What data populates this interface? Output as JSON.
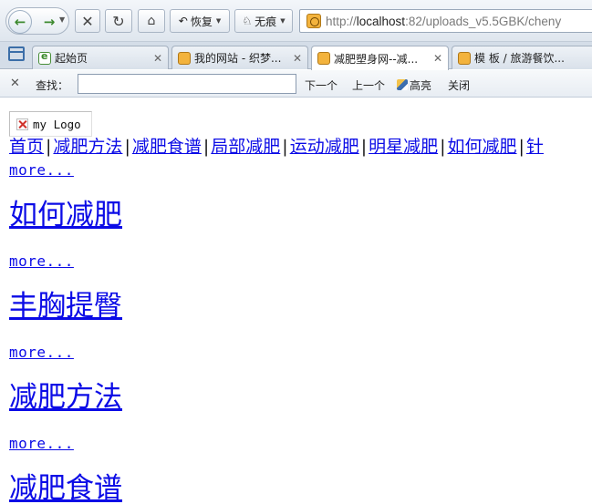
{
  "toolbar": {
    "restore_label": "恢复",
    "private_label": "无痕",
    "url_prefix": "http://",
    "url_host": "localhost",
    "url_rest": ":82/uploads_v5.5GBK/cheny"
  },
  "tabs": [
    {
      "label": "起始页",
      "active": false
    },
    {
      "label": "我的网站 - 织梦...",
      "active": false
    },
    {
      "label": "减肥塑身网--减...",
      "active": true
    },
    {
      "label": "模 板 / 旅游餐饮...",
      "active": false
    }
  ],
  "findbar": {
    "label": "查找：",
    "query": "",
    "next_label": "下一个",
    "prev_label": "上一个",
    "highlight_label": "高亮",
    "close_label": "关闭"
  },
  "page": {
    "logo_alt": "my Logo",
    "nav": [
      "首页",
      "减肥方法",
      "减肥食谱",
      "局部减肥",
      "运动减肥",
      "明星减肥",
      "如何减肥",
      "针"
    ],
    "sections": [
      {
        "more": "more...",
        "title": "如何减肥"
      },
      {
        "more": "more...",
        "title": "丰胸提臀"
      },
      {
        "more": "more...",
        "title": "减肥方法"
      },
      {
        "more": "more...",
        "title": "减肥食谱"
      }
    ]
  },
  "colors": {
    "link": "#0b0be6",
    "chrome": "#dfe6ee"
  }
}
